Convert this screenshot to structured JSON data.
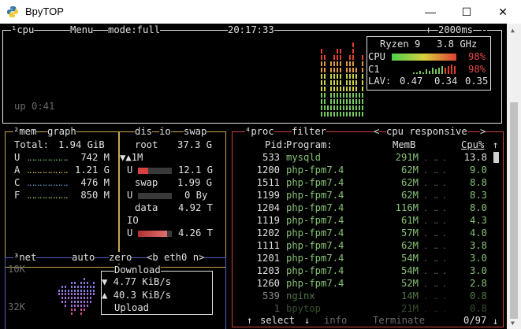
{
  "window": {
    "title": "BpyTOP",
    "minimize": "—",
    "maximize": "☐",
    "close": "✕"
  },
  "cpu_box": {
    "tag": "¹cpu",
    "menu": "Menu",
    "mode": "mode:full",
    "clock": "20:17:33",
    "interval_minus": "-",
    "interval": "2000ms",
    "interval_plus": "+",
    "uptime": "up 0:41",
    "cpu_name": "Ryzen 9",
    "freq": "3.8 GHz",
    "cpu_label": "CPU",
    "cpu_pct": "98%",
    "c1_label": "C1",
    "c1_pct": "98%",
    "lav_label": "LAV:",
    "lav": [
      "0.47",
      "0.34",
      "0.35"
    ]
  },
  "mem_box": {
    "tag": "²mem",
    "graph": "graph",
    "total_label": "Total:",
    "total": "1.94 GiB",
    "rows": [
      {
        "label": "U",
        "value": "742 M",
        "color": "#86c275"
      },
      {
        "label": "A",
        "value": "1.21 G",
        "color": "#d6c15e"
      },
      {
        "label": "C",
        "value": "476 M",
        "color": "#6a9bd8"
      },
      {
        "label": "F",
        "value": "850 M",
        "color": "#a8d06a"
      }
    ]
  },
  "disk_box": {
    "dis": "dis",
    "io": "io",
    "swap": "swap",
    "root_label": "root",
    "root_size": "37.3 G",
    "io_line": "▼▲1M",
    "root_u_label": "U",
    "root_u_value": "12.1 G",
    "swap_label": "swap",
    "swap_size": "1.99 G",
    "swap_u_label": "U",
    "swap_u_value": "0 By",
    "data_label": "data",
    "data_size": "4.92 T",
    "io_label": "IO",
    "data_u_label": "U",
    "data_u_value": "4.26 T"
  },
  "net_box": {
    "tag": "³net",
    "auto": "auto",
    "zero": "zero",
    "iface": "<b eth0 n>",
    "top_scale": "10K",
    "bottom_scale": "32K",
    "download_label": "Download",
    "download_rate": "▼ 4.77 KiB/s",
    "upload_rate": "▲ 40.3 KiB/s",
    "upload_label": "Upload"
  },
  "proc_box": {
    "tag": "⁴proc",
    "filter": "filter",
    "sort_left": "<",
    "sort": "cpu responsive",
    "sort_right": ">",
    "columns": {
      "pid": "Pid:",
      "program": "Program:",
      "mem": "MemB",
      "cpu": "Cpu%"
    },
    "rows": [
      {
        "pid": "533",
        "program": "mysqld",
        "mem": "291M",
        "cpu": "13.8"
      },
      {
        "pid": "1200",
        "program": "php-fpm7.4",
        "mem": "62M",
        "cpu": "9.0"
      },
      {
        "pid": "1511",
        "program": "php-fpm7.4",
        "mem": "62M",
        "cpu": "8.8"
      },
      {
        "pid": "1199",
        "program": "php-fpm7.4",
        "mem": "62M",
        "cpu": "8.3"
      },
      {
        "pid": "1204",
        "program": "php-fpm7.4",
        "mem": "116M",
        "cpu": "8.0"
      },
      {
        "pid": "1119",
        "program": "php-fpm7.4",
        "mem": "61M",
        "cpu": "4.3"
      },
      {
        "pid": "1202",
        "program": "php-fpm7.4",
        "mem": "57M",
        "cpu": "4.0"
      },
      {
        "pid": "1111",
        "program": "php-fpm7.4",
        "mem": "62M",
        "cpu": "3.8"
      },
      {
        "pid": "1201",
        "program": "php-fpm7.4",
        "mem": "54M",
        "cpu": "3.0"
      },
      {
        "pid": "1203",
        "program": "php-fpm7.4",
        "mem": "54M",
        "cpu": "3.0"
      },
      {
        "pid": "1260",
        "program": "php-fpm7.4",
        "mem": "52M",
        "cpu": "2.8"
      },
      {
        "pid": "539",
        "program": "nginx",
        "mem": "14M",
        "cpu": "0.8"
      },
      {
        "pid": "1",
        "program": "bpytop",
        "mem": "21M",
        "cpu": "0.8"
      }
    ],
    "footer": {
      "up": "↑",
      "select": "select",
      "down": "↓",
      "info": "info",
      "terminate": "Terminate",
      "count": "0/97"
    }
  },
  "colors": {
    "cpu_border": "#e3e3e3",
    "mem_border": "#c9a84f",
    "proc_border": "#d04040",
    "net_border": "#5460c8"
  }
}
